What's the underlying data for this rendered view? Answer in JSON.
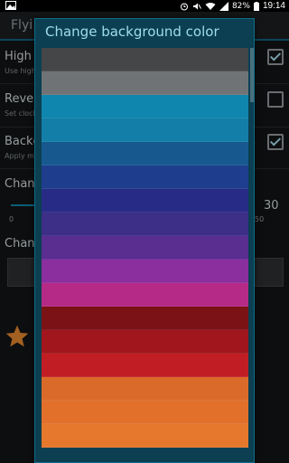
{
  "status_bar": {
    "battery": "82%",
    "time": "19:14"
  },
  "app": {
    "title": "Flyi"
  },
  "settings": [
    {
      "title": "High",
      "subtitle": "Use high",
      "checked": true
    },
    {
      "title": "Rever",
      "subtitle": "Set clock",
      "checked": false
    },
    {
      "title": "Backg",
      "subtitle": "Apply ma",
      "checked": true
    }
  ],
  "slider": {
    "label": "Chan",
    "min_label": "0",
    "max_label": "50",
    "value": "30",
    "fill_fraction": 0.1
  },
  "change_section": {
    "label": "Chan"
  },
  "dialog": {
    "title": "Change background color",
    "colors": [
      "#444648",
      "#707376",
      "#0f86ad",
      "#137fa8",
      "#17598f",
      "#1e3e8d",
      "#282b86",
      "#3d2e87",
      "#5a2d91",
      "#8b2e9e",
      "#b52a86",
      "#7b1216",
      "#a0161c",
      "#c11d24",
      "#da6a2a",
      "#e2702b",
      "#e5782d"
    ]
  }
}
